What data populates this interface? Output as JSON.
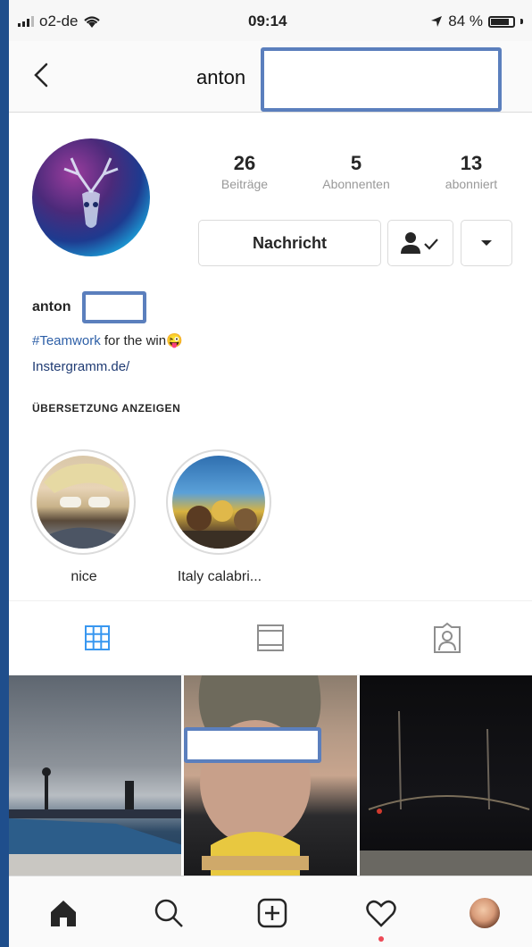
{
  "status_bar": {
    "carrier": "o2-de",
    "time": "09:14",
    "battery": "84 %"
  },
  "nav": {
    "title": "anton"
  },
  "profile": {
    "stats": [
      {
        "value": "26",
        "label": "Beiträge"
      },
      {
        "value": "5",
        "label": "Abonnenten"
      },
      {
        "value": "13",
        "label": "abonniert"
      }
    ],
    "message_button": "Nachricht",
    "name": "anton",
    "bio_hashtag": "#Teamwork",
    "bio_text": " for the win",
    "bio_emoji": "😜",
    "link": "Instergramm.de/",
    "translate": "ÜBERSETZUNG ANZEIGEN"
  },
  "highlights": [
    {
      "label": "nice"
    },
    {
      "label": "Italy calabri..."
    }
  ],
  "colors": {
    "accent_blue": "#3897f0",
    "link_blue": "#1f3b73",
    "notification_red": "#ed4956",
    "redaction_border": "#5b7fbd"
  },
  "icons": {
    "nav": [
      "back-chevron-icon"
    ],
    "tabs": [
      "grid-icon",
      "feed-icon",
      "tagged-icon"
    ],
    "bottom": [
      "home-icon",
      "search-icon",
      "add-icon",
      "heart-icon",
      "profile-avatar"
    ]
  }
}
